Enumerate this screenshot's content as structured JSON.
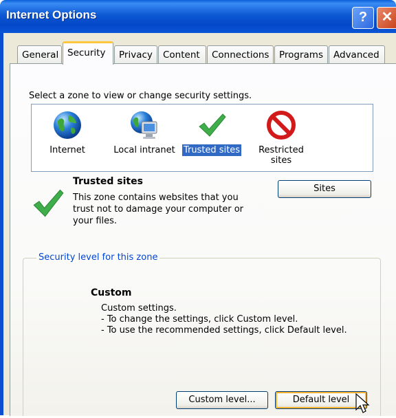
{
  "window": {
    "title": "Internet Options",
    "help_glyph": "?",
    "close_glyph": "✕"
  },
  "tabs": [
    "General",
    "Security",
    "Privacy",
    "Content",
    "Connections",
    "Programs",
    "Advanced"
  ],
  "active_tab": "Security",
  "zones_prompt": "Select a zone to view or change security settings.",
  "zones": [
    {
      "label": "Internet",
      "icon": "globe-icon"
    },
    {
      "label": "Local intranet",
      "icon": "intranet-icon"
    },
    {
      "label": "Trusted sites",
      "icon": "checkmark-icon",
      "selected": true
    },
    {
      "label": "Restricted sites",
      "icon": "no-entry-icon"
    }
  ],
  "zone_info": {
    "title": "Trusted sites",
    "description": "This zone contains websites that you trust not to damage your computer or your files.",
    "sites_button": "Sites"
  },
  "security_level": {
    "group_label": "Security level for this zone",
    "level": "Custom",
    "lines": [
      "Custom settings.",
      "- To change the settings, click Custom level.",
      "- To use the recommended settings, click Default level."
    ],
    "custom_level_button": "Custom level...",
    "default_level_button": "Default level"
  },
  "colors": {
    "titlebar": "#0a56d6",
    "selection": "#316ac5",
    "legend": "#0046d5",
    "tab_highlight": "#ffc83c"
  }
}
